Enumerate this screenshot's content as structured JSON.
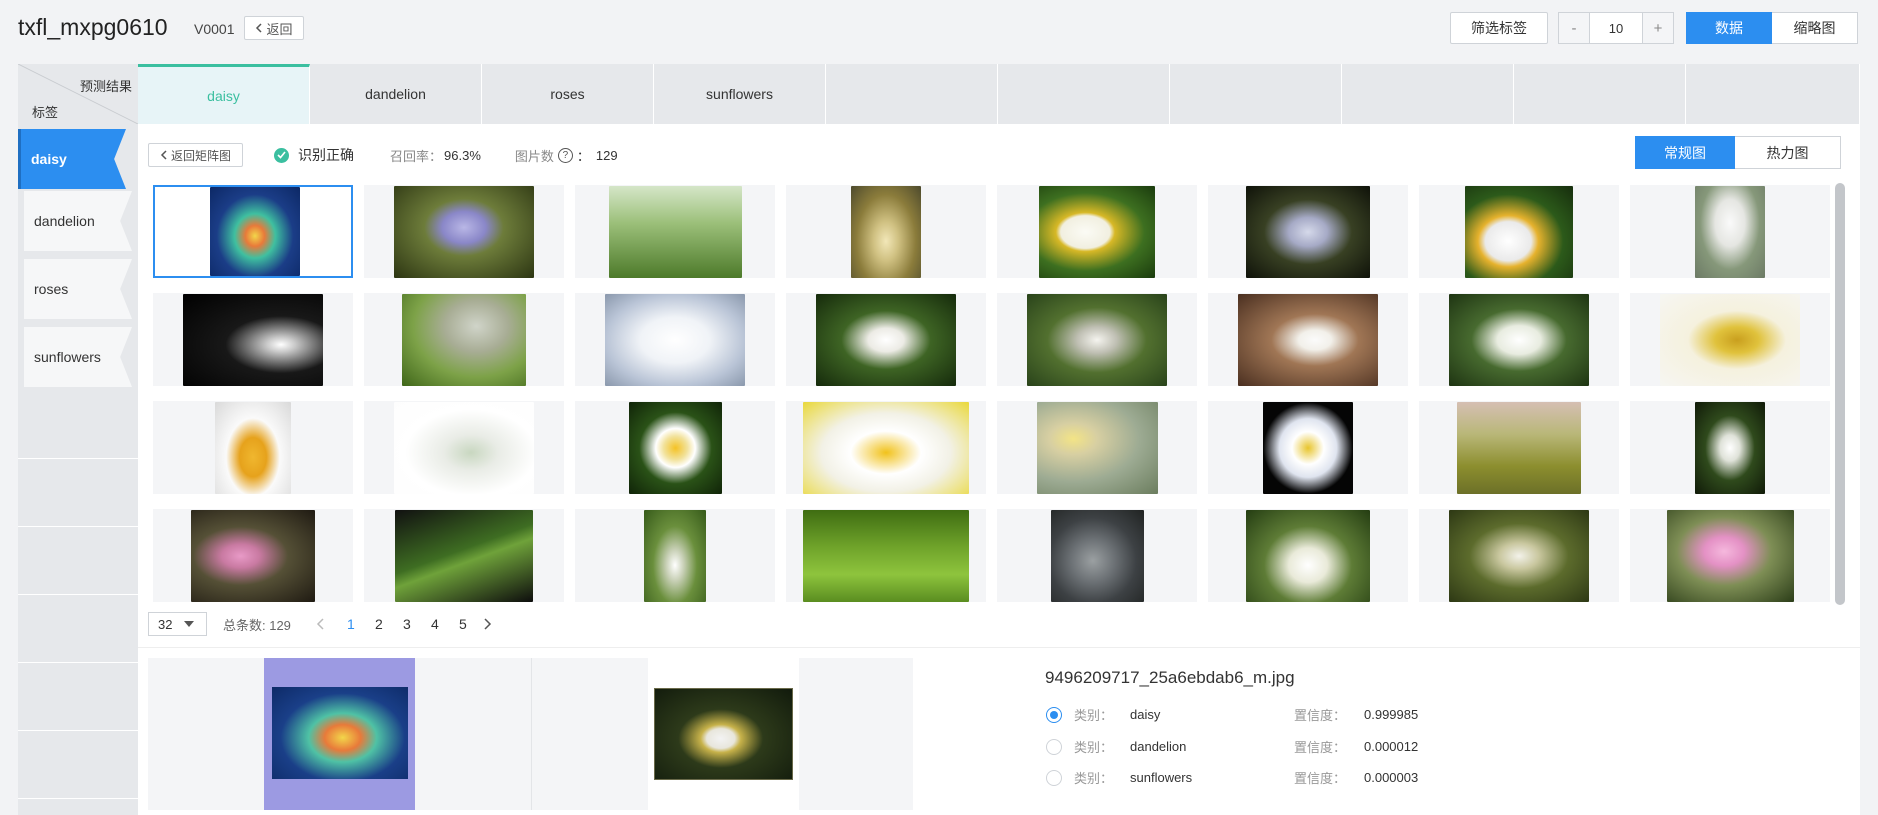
{
  "header": {
    "title": "txfl_mxpg0610",
    "version": "V0001",
    "back_label": "返回",
    "filter_label": "筛选标签",
    "stepper": {
      "minus": "-",
      "value": "10",
      "plus": "+"
    },
    "view_modes": [
      "数据",
      "缩略图"
    ]
  },
  "matrix": {
    "corner_top": "预测结果",
    "corner_bottom": "标签",
    "columns": [
      "daisy",
      "dandelion",
      "roses",
      "sunflowers"
    ],
    "rows": [
      "daisy",
      "dandelion",
      "roses",
      "sunflowers"
    ],
    "active_column": "daisy",
    "active_row": "daisy"
  },
  "toolbar": {
    "back_label": "返回矩阵图",
    "status": "识别正确",
    "recall_label": "召回率：",
    "recall_value": "96.3%",
    "count_label": "图片数",
    "count_sep": "：",
    "count_value": "129",
    "view_tabs": [
      "常规图",
      "热力图"
    ]
  },
  "pagination": {
    "page_size": "32",
    "total_label": "总条数: 129",
    "pages": [
      "1",
      "2",
      "3",
      "4",
      "5"
    ],
    "current": "1"
  },
  "detail": {
    "filename": "9496209717_25a6ebdab6_m.jpg",
    "predictions": [
      {
        "cls_label": "类别：",
        "cls": "daisy",
        "conf_label": "置信度：",
        "conf": "0.999985",
        "selected": true
      },
      {
        "cls_label": "类别：",
        "cls": "dandelion",
        "conf_label": "置信度：",
        "conf": "0.000012",
        "selected": false
      },
      {
        "cls_label": "类别：",
        "cls": "sunflowers",
        "conf_label": "置信度：",
        "conf": "0.000003",
        "selected": false
      }
    ]
  },
  "colors": {
    "primary": "#2c8ef0",
    "success": "#3bbfa0"
  }
}
